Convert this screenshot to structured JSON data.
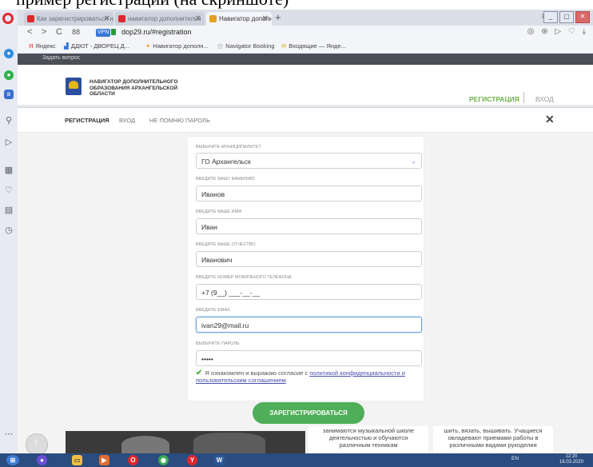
{
  "caption": "пример регистрации (на скриншоте)",
  "browser": {
    "tabs": [
      {
        "label": "Как зарегистрироваться н",
        "fav_color": "#e0262c"
      },
      {
        "label": "навигатор дополнительн",
        "fav_color": "#e0262c"
      },
      {
        "label": "Навигатор дополнительн",
        "fav_color": "#e8a020"
      }
    ],
    "back": "<",
    "forward": ">",
    "reload": "C",
    "grid": "88",
    "vpn": "VPN",
    "url": "dop29.ru/#registration",
    "tools": "◎ ⊛ ▷ ♡ ⤓",
    "bookmarks": [
      "Яндекс",
      "ДДЮТ - ДВОРЕЦ Д...",
      "Навигатор дополн...",
      "Navigator Booking",
      "Входящие — Янде..."
    ],
    "window_controls": [
      "_",
      "▢",
      "✕"
    ]
  },
  "sidebar_icons": [
    "messenger-icon",
    "whatsapp-icon",
    "vk-icon",
    "search-icon",
    "send-icon",
    "speed-dial-icon",
    "heart-icon",
    "news-icon",
    "history-icon",
    "more-icon"
  ],
  "site": {
    "top_strip": "Задать вопрос",
    "title": "НАВИГАТОР ДОПОЛНИТЕЛЬНОГО\nОБРАЗОВАНИЯ АРХАНГЕЛЬСКОЙ\nОБЛАСТИ",
    "register_link": "РЕГИСТРАЦИЯ",
    "login_link": "ВХОД",
    "accent": "#6fb24a"
  },
  "form_tabs": [
    "РЕГИСТРАЦИЯ",
    "ВХОД",
    "НЕ ПОМНЮ ПАРОЛЬ"
  ],
  "close": "✕",
  "form": {
    "municipality_label": "ВЫБЕРИТЕ МУНИЦИПАЛИТЕТ",
    "municipality_value": "ГО Архангельск",
    "surname_label": "ВВЕДИТЕ ВАШУ ФАМИЛИЮ",
    "surname_value": "Иванов",
    "name_label": "ВВЕДИТЕ ВАШЕ ИМЯ",
    "name_value": "Иван",
    "patronymic_label": "ВВЕДИТЕ ВАШЕ ОТЧЕСТВО",
    "patronymic_value": "Иванович",
    "phone_label": "ВВЕДИТЕ НОМЕР МОБИЛЬНОГО ТЕЛЕФОНА",
    "phone_value": "+7 (9__) ___-__-__",
    "email_label": "ВВЕДИТЕ EMAIL",
    "email_value": "ivan29@mail.ru",
    "password_label": "ВЫБЕРИТЕ ПАРОЛЬ",
    "password_value": "•••••",
    "agree_text": "Я ознакомлен и выражаю согласие с ",
    "agree_link": "политикой конфиденциальности и пользовательским соглашением",
    "submit": "ЗАРЕГИСТРИРОВАТЬСЯ"
  },
  "bottom_cards": [
    "занимаются музыкальной школе\nдеятельностью и обучаются\nразличным техникам",
    "шить, вязать, вышивать. Учащиеся\nовладевают приемами работы в\nразличными видами рукоделия"
  ],
  "taskbar": {
    "lang": "EN",
    "time": "12:20",
    "date": "16.03.2020",
    "color": "#2b4c7e"
  }
}
